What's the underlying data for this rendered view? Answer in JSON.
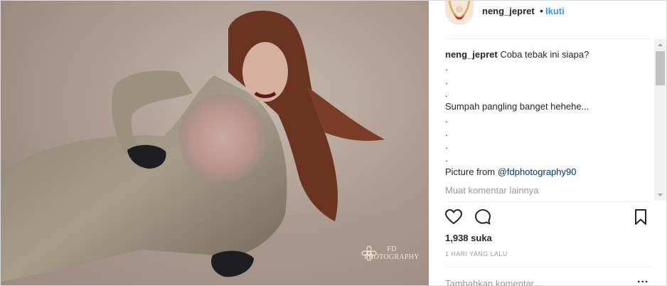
{
  "post": {
    "username": "neng_jepret",
    "separator": "•",
    "follow_label": "Ikuti",
    "photo_alt": "fashion photo",
    "watermark_text": "FD PHOTOGRAPHY"
  },
  "caption": {
    "username": "neng_jepret",
    "first_line": "Coba tebak ini siapa?",
    "lines": [
      ".",
      ".",
      ".",
      "Sumpah pangling banget hehehe...",
      ".",
      ".",
      ".",
      "."
    ],
    "credit_prefix": "Picture from ",
    "credit_mention": "@fdphotography90"
  },
  "load_more_label": "Muat komentar lainnya",
  "actions": {
    "like_icon": "heart-outline-icon",
    "comment_icon": "comment-bubble-icon",
    "save_icon": "bookmark-icon"
  },
  "likes_label": "1,938 suka",
  "timestamp": "1 HARI YANG LALU",
  "comment_input": {
    "placeholder": "Tambahkan komentar..."
  },
  "more_label": "...",
  "colors": {
    "accent": "#3897f0",
    "mention": "#003569",
    "muted": "#999999"
  }
}
